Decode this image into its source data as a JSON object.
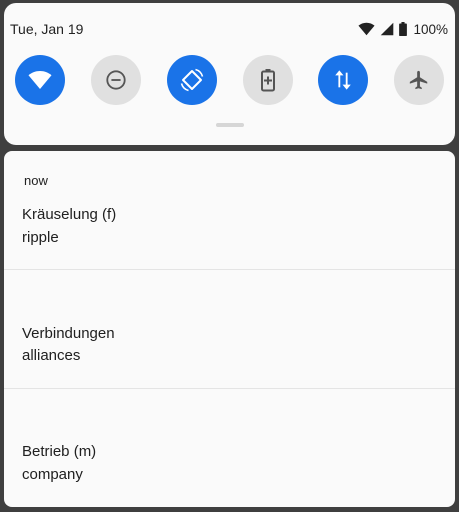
{
  "status_bar": {
    "date": "Tue, Jan 19",
    "battery_percent": "100%",
    "icons": [
      "wifi-signal-icon",
      "cell-signal-icon",
      "battery-icon"
    ]
  },
  "quick_settings": {
    "tiles": [
      {
        "name": "wifi",
        "icon": "wifi-icon",
        "state": "on"
      },
      {
        "name": "do-not-disturb",
        "icon": "minus-circle-icon",
        "state": "off"
      },
      {
        "name": "auto-rotate",
        "icon": "rotate-icon",
        "state": "on"
      },
      {
        "name": "battery-saver",
        "icon": "battery-saver-icon",
        "state": "off"
      },
      {
        "name": "mobile-data",
        "icon": "data-arrows-icon",
        "state": "on"
      },
      {
        "name": "airplane-mode",
        "icon": "airplane-icon",
        "state": "off"
      }
    ],
    "colors": {
      "on": "#1a73e8",
      "off": "#e0e0e0"
    }
  },
  "notification": {
    "time": "now",
    "items": [
      {
        "title": "Kräuselung (f)",
        "text": "ripple"
      },
      {
        "title": "Verbindungen",
        "text": "alliances"
      },
      {
        "title": "Betrieb (m)",
        "text": "company"
      }
    ]
  }
}
